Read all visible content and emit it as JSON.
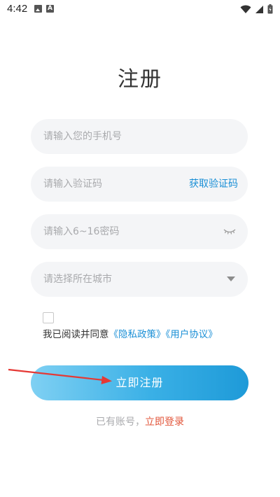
{
  "status_bar": {
    "time": "4:42",
    "left_icons": [
      "photo-icon",
      "font-icon"
    ],
    "right_icons": [
      "wifi-icon",
      "signal-icon",
      "battery-icon"
    ],
    "font_icon_glyph": "A"
  },
  "page": {
    "title": "注册"
  },
  "form": {
    "phone_placeholder": "请输入您的手机号",
    "code_placeholder": "请输入验证码",
    "get_code_label": "获取验证码",
    "password_placeholder": "请输入6~16密码",
    "city_placeholder": "请选择所在城市"
  },
  "agreement": {
    "prefix": "我已阅读并同意",
    "privacy_link": "《隐私政策》",
    "user_link": "《用户协议》",
    "checked": false
  },
  "actions": {
    "register_label": "立即注册",
    "has_account_text": "已有账号，",
    "login_link": "立即登录"
  },
  "colors": {
    "link_blue": "#1a8fd6",
    "login_red": "#e2553a",
    "button_gradient_start": "#7fd0f3",
    "button_gradient_end": "#1e9ad8",
    "field_bg": "#f4f5f7",
    "annotation_arrow": "#e53935"
  }
}
